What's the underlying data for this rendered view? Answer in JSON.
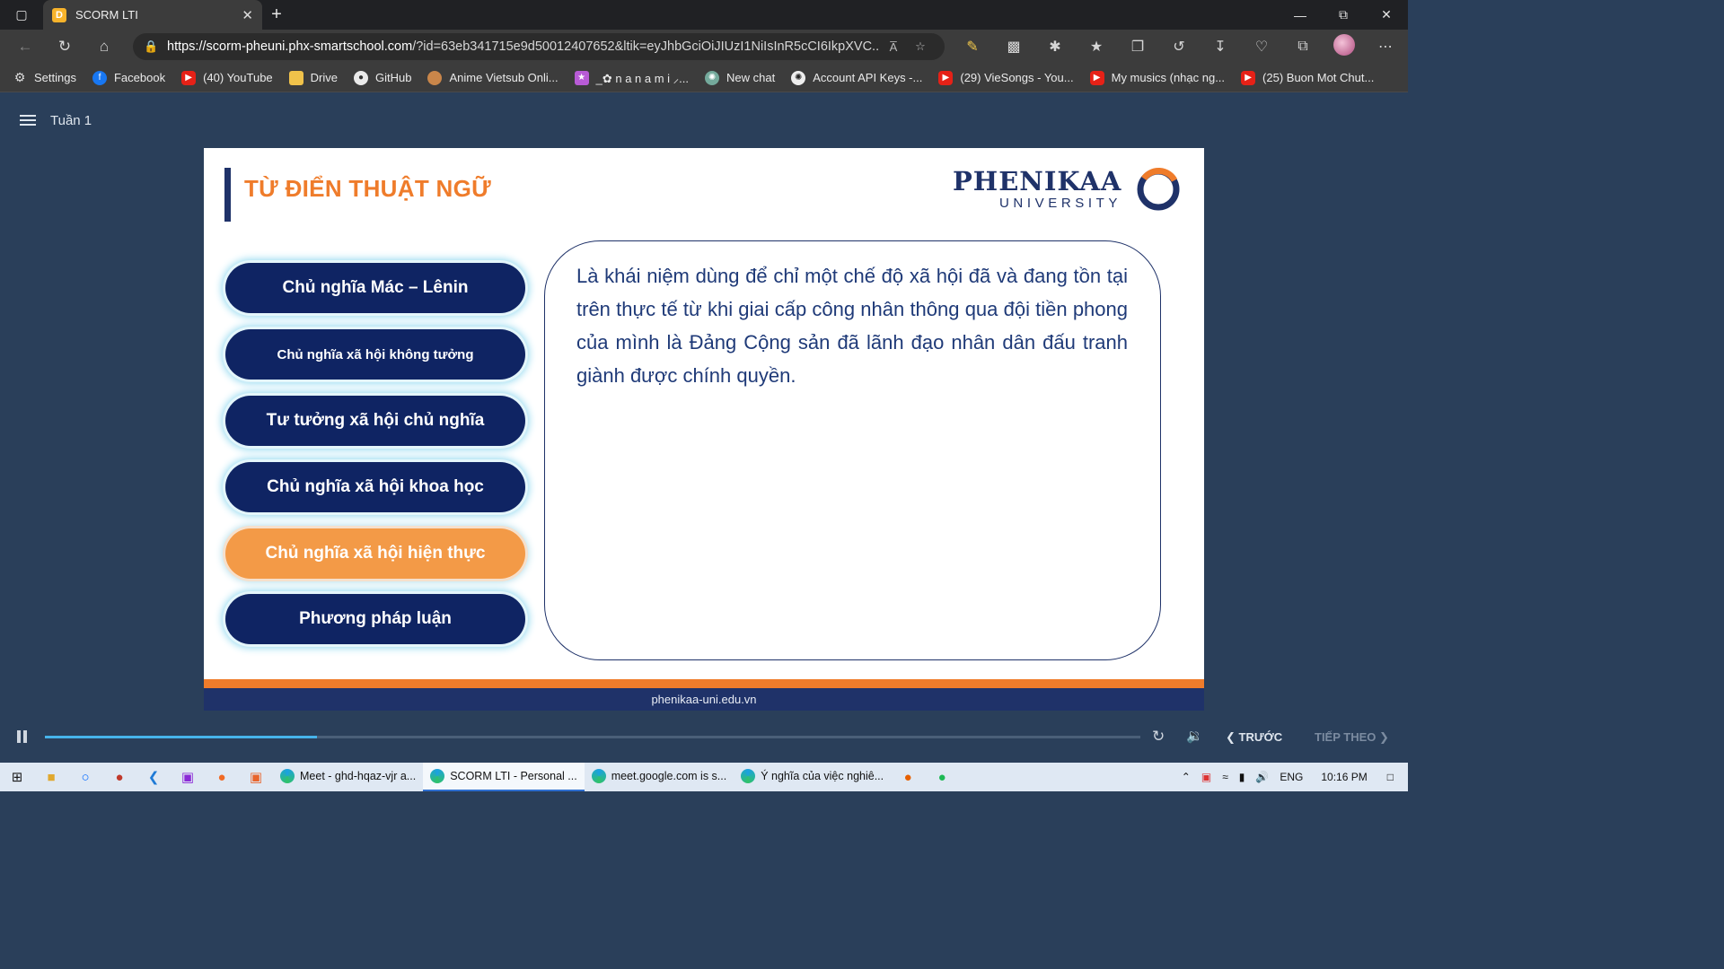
{
  "browser": {
    "tab_title": "SCORM LTI",
    "tab_favicon_letter": "D",
    "url_host": "https://scorm-pheuni.phx-smartschool.com",
    "url_path": "/?id=63eb341715e9d50012407652&ltik=eyJhbGciOiJIUzI1NiIsInR5cCI6IkpXVC...",
    "read_aloud": "A̅",
    "bookmarks": [
      {
        "label": "Settings",
        "icon": "gear-icon"
      },
      {
        "label": "Facebook",
        "icon": "facebook-icon"
      },
      {
        "label": "(40) YouTube",
        "icon": "youtube-icon"
      },
      {
        "label": "Drive",
        "icon": "folder-icon"
      },
      {
        "label": "GitHub",
        "icon": "github-icon"
      },
      {
        "label": "Anime Vietsub Onli...",
        "icon": "anime-icon"
      },
      {
        "label": "_✿ n a n a m i ⸝...",
        "icon": "nanami-icon"
      },
      {
        "label": "New chat",
        "icon": "chatgpt-icon"
      },
      {
        "label": "Account API Keys -...",
        "icon": "openai-icon"
      },
      {
        "label": "(29) VieSongs - You...",
        "icon": "youtube-icon"
      },
      {
        "label": "My musics (nhạc ng...",
        "icon": "youtube-icon"
      },
      {
        "label": "(25) Buon Mot Chut...",
        "icon": "youtube-icon"
      }
    ]
  },
  "player": {
    "menu_title": "Tuần 1",
    "progress_fraction": 0.248,
    "prev_label": "TRƯỚC",
    "next_label": "TIẾP THEO"
  },
  "slide": {
    "title": "TỪ ĐIỂN THUẬT NGỮ",
    "logo_word": "PHENIKAA",
    "logo_sub": "UNIVERSITY",
    "terms": [
      {
        "label": "Chủ nghĩa Mác – Lênin",
        "active": false
      },
      {
        "label": "Chủ nghĩa xã hội không tưởng",
        "active": false
      },
      {
        "label": "Tư tưởng xã hội chủ nghĩa",
        "active": false
      },
      {
        "label": "Chủ nghĩa xã hội khoa học",
        "active": false
      },
      {
        "label": "Chủ nghĩa xã hội hiện thực",
        "active": true
      },
      {
        "label": "Phương pháp luận",
        "active": false
      }
    ],
    "definition": "Là khái niệm dùng để chỉ một chế độ xã hội đã và đang tồn tại trên thực tế từ khi giai cấp công nhân thông qua đội tiền phong của mình là Đảng Cộng sản đã lãnh đạo nhân dân đấu tranh giành được chính quyền.",
    "footer_url": "phenikaa-uni.edu.vn",
    "colors": {
      "navy": "#0f2463",
      "orange": "#ef7c2b",
      "active_term": "#f39a47"
    }
  },
  "taskbar": {
    "apps": [
      {
        "label": "Meet - ghd-hqaz-vjr a...",
        "active": false
      },
      {
        "label": "SCORM LTI - Personal ...",
        "active": true
      },
      {
        "label": "meet.google.com is s...",
        "active": false
      },
      {
        "label": "Ý nghĩa của việc nghiê...",
        "active": false
      }
    ],
    "lang": "ENG",
    "time": "10:16 PM"
  }
}
